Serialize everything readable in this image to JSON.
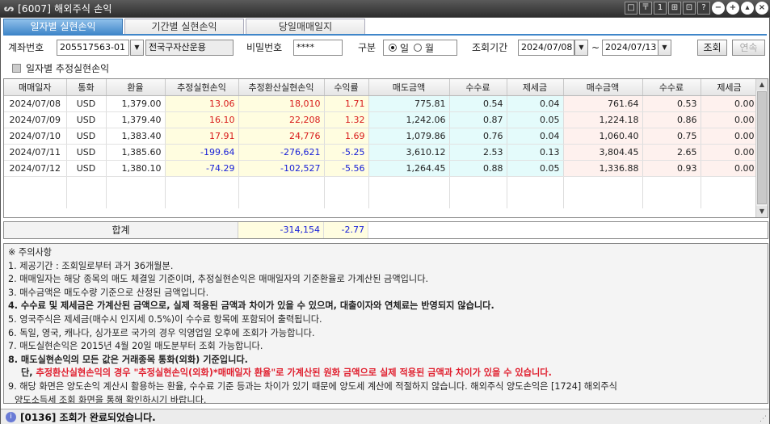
{
  "window": {
    "title": "[6007] 해외주식 손익",
    "logo": "ᔕ"
  },
  "window_buttons": [
    "□",
    "〒",
    "1",
    "⊞",
    "⊡",
    "?"
  ],
  "tabs": [
    {
      "label": "일자별 실현손익",
      "active": true
    },
    {
      "label": "기간별 실현손익",
      "active": false
    },
    {
      "label": "당일매매일지",
      "active": false
    }
  ],
  "form": {
    "account_label": "계좌번호",
    "account_number": "205517563-01",
    "account_name": "전국구자산운용",
    "password_label": "비밀번호",
    "password_value": "****",
    "type_label": "구분",
    "radio_daily": "일",
    "radio_monthly": "월",
    "period_label": "조회기간",
    "date_from": "2024/07/08",
    "tilde": "~",
    "date_to": "2024/07/13",
    "query_button": "조회",
    "continue_button": "연속",
    "checkbox_label": "일자별 추정실현손익"
  },
  "table": {
    "headers": [
      "매매일자",
      "통화",
      "환율",
      "추정실현손익",
      "추정환산실현손익",
      "수익률",
      "매도금액",
      "수수료",
      "제세금",
      "매수금액",
      "수수료",
      "제세금"
    ],
    "rows": [
      [
        "2024/07/08",
        "USD",
        "1,379.00",
        "13.06",
        "18,010",
        "1.71",
        "775.81",
        "0.54",
        "0.04",
        "761.64",
        "0.53",
        "0.00"
      ],
      [
        "2024/07/09",
        "USD",
        "1,379.40",
        "16.10",
        "22,208",
        "1.32",
        "1,242.06",
        "0.87",
        "0.05",
        "1,224.18",
        "0.86",
        "0.00"
      ],
      [
        "2024/07/10",
        "USD",
        "1,383.40",
        "17.91",
        "24,776",
        "1.69",
        "1,079.86",
        "0.76",
        "0.04",
        "1,060.40",
        "0.75",
        "0.00"
      ],
      [
        "2024/07/11",
        "USD",
        "1,385.60",
        "-199.64",
        "-276,621",
        "-5.25",
        "3,610.12",
        "2.53",
        "0.13",
        "3,804.45",
        "2.65",
        "0.00"
      ],
      [
        "2024/07/12",
        "USD",
        "1,380.10",
        "-74.29",
        "-102,527",
        "-5.56",
        "1,264.45",
        "0.88",
        "0.05",
        "1,336.88",
        "0.93",
        "0.00"
      ]
    ]
  },
  "summary": {
    "label": "합계",
    "total_realized": "-314,154",
    "total_return": "-2.77"
  },
  "notes": {
    "header": "※ 주의사항",
    "items": [
      "1. 제공기간 : 조회일로부터 과거 36개월분.",
      "2. 매매일자는 해당 종목의 매도 체결일 기준이며, 추정실현손익은 매매일자의 기준환율로 가계산된 금액입니다.",
      "3. 매수금액은 매도수량 기준으로 산정된 금액입니다.",
      "4. 수수료 및 제세금은 가계산된 금액으로, 실제 적용된 금액과 차이가 있을 수 있으며, 대출이자와 연체료는 반영되지 않습니다.",
      "5. 영국주식은 제세금(매수시 인지세 0.5%)이 수수료 항목에 포함되어 출력됩니다.",
      "6. 독일, 영국, 캐나다, 싱가포르 국가의 경우 익영업일 오후에 조회가 가능합니다.",
      "7. 매도실현손익은 2015년 4월 20일 매도분부터 조회 가능합니다.",
      "8. 매도실현손익의 모든 값은 거래종목 통화(외화) 기준입니다."
    ],
    "item8_cont_prefix": "단, ",
    "item8_cont_red": "추정환산실현손익의 경우 \"추정실현손익(외화)*매매일자 환율\"로 가계산된 원화 금액으로 실제 적용된 금액과 차이가 있을 수 있습니다.",
    "item9_line1": "9. 해당 화면은 양도손익 계산시 활용하는 환율, 수수료 기준 등과는 차이가 있기 때문에 양도세 계산에 적절하지 않습니다. 해외주식 양도손익은 [1724] 해외주식",
    "item9_line2": "양도소득세 조회 화면을 통해 확인하시기 바랍니다."
  },
  "status": {
    "icon": "i",
    "message": "[0136] 조회가 완료되었습니다."
  },
  "colors": {
    "tab_active": "#3f86c9",
    "negative": "#1a22d8",
    "positive": "#d81a1a",
    "note_red": "#e0202f"
  }
}
